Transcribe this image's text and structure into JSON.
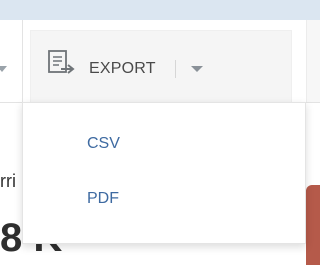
{
  "toolbar": {
    "export": {
      "label": "EXPORT",
      "icon": "export-icon"
    }
  },
  "dropdown": {
    "items": [
      {
        "label": "CSV"
      },
      {
        "label": "PDF"
      }
    ]
  },
  "background": {
    "left_text_small": "rri",
    "left_text_large": "8 K"
  },
  "colors": {
    "accent_link": "#3e6aa1",
    "top_strip": "#dbe6f1",
    "right_card": "#b55a4a"
  }
}
